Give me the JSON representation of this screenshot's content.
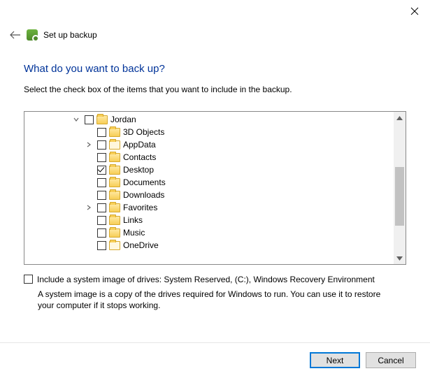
{
  "window": {
    "title": "Set up backup",
    "heading": "What do you want to back up?",
    "description": "Select the check box of the items that you want to include in the backup."
  },
  "tree": {
    "root": "Jordan",
    "root_checked": false,
    "items": [
      {
        "label": "3D Objects",
        "checked": false,
        "empty": false,
        "expander": false
      },
      {
        "label": "AppData",
        "checked": false,
        "empty": true,
        "expander": true
      },
      {
        "label": "Contacts",
        "checked": false,
        "empty": false,
        "expander": false
      },
      {
        "label": "Desktop",
        "checked": true,
        "empty": false,
        "expander": false
      },
      {
        "label": "Documents",
        "checked": false,
        "empty": false,
        "expander": false
      },
      {
        "label": "Downloads",
        "checked": false,
        "empty": false,
        "expander": false
      },
      {
        "label": "Favorites",
        "checked": false,
        "empty": false,
        "expander": true
      },
      {
        "label": "Links",
        "checked": false,
        "empty": false,
        "expander": false
      },
      {
        "label": "Music",
        "checked": false,
        "empty": false,
        "expander": false
      },
      {
        "label": "OneDrive",
        "checked": false,
        "empty": true,
        "expander": false
      }
    ]
  },
  "system_image": {
    "checkbox_label": "Include a system image of drives: System Reserved, (C:), Windows Recovery Environment",
    "checked": false,
    "note": "A system image is a copy of the drives required for Windows to run. You can use it to restore your computer if it stops working."
  },
  "buttons": {
    "next": "Next",
    "cancel": "Cancel"
  }
}
